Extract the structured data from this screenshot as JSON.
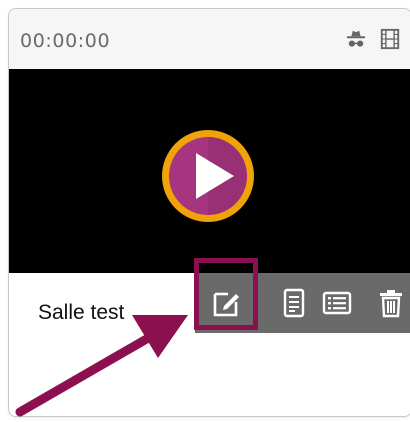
{
  "card": {
    "timecode": "00:00:00",
    "title": "Salle test"
  },
  "icons": {
    "header_left": "spy-icon",
    "header_right": "film-icon",
    "play": "play-icon",
    "actions": [
      "edit-icon",
      "document-icon",
      "list-icon",
      "trash-icon"
    ]
  },
  "colors": {
    "play_ring": "#f0a20a",
    "play_fill": "#a63580",
    "annotation": "#8c1050",
    "action_bar": "#6a6a6a"
  }
}
